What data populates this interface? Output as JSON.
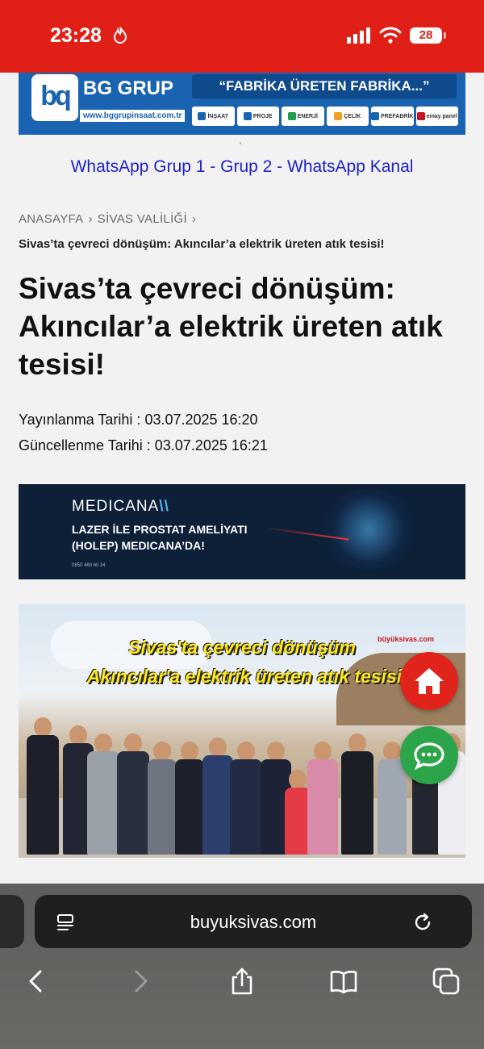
{
  "status_bar": {
    "time": "23:28",
    "battery": "28",
    "accent": "#e01f17"
  },
  "top_banner": {
    "brand": "BG GRUP",
    "url": "www.bggrupinsaat.com.tr",
    "slogan": "“FABRİKA ÜRETEN FABRİKA...”",
    "brands": [
      "İNŞAAT",
      "PROJE",
      "ENERJİ",
      "ÇELİK",
      "PREFABRİK",
      "emay panel"
    ]
  },
  "whatsapp_links": "WhatsApp Grup 1 - Grup 2 - WhatsApp Kanal",
  "breadcrumb": {
    "home": "ANASAYFA",
    "category": "SİVAS VALİLİĞİ",
    "current": "Sivas’ta çevreci dönüşüm: Akıncılar’a elektrik üreten atık tesisi!"
  },
  "article": {
    "title": "Sivas’ta çevreci dönüşüm: Akıncılar’a elektrik üreten atık tesisi!",
    "published_label": "Yayınlanma Tarihi :",
    "published": "03.07.2025 16:20",
    "updated_label": "Güncellenme Tarihi :",
    "updated": "03.07.2025 16:21"
  },
  "ad": {
    "brand": "MEDICANA",
    "line1": "LAZER İLE PROSTAT AMELİYATI",
    "line2": "(HOLEP) MEDICANA’DA!",
    "phone": "0850 460 60 34"
  },
  "photo": {
    "caption_line1": "Sivas'ta çevreci dönüşüm",
    "caption_line2": "Akıncılar'a elektrik üreten atık tesisi",
    "watermark": "büyüksivas.com"
  },
  "fabs": {
    "home_icon": "home-icon",
    "chat_icon": "chat-icon"
  },
  "browser": {
    "url": "buyuksivas.com"
  }
}
